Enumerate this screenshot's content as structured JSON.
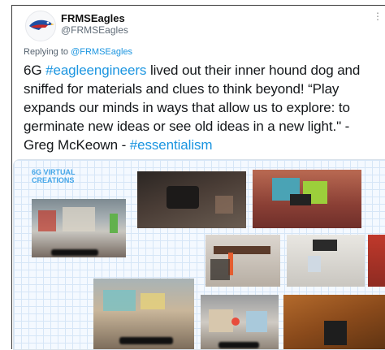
{
  "tweet": {
    "display_name": "FRMSEagles",
    "handle": "@FRMSEagles",
    "more_icon": "more-icon",
    "replying_prefix": "Replying to ",
    "replying_to": "@FRMSEagles",
    "text_1": "6G ",
    "hashtag_1": "#eagleengineers",
    "text_2": " lived out their inner hound dog and sniffed for materials and clues to think beyond! “Play expands our minds in ways that allow us to explore: to germinate new ideas or see old ideas in a new light.\" - Greg McKeown - ",
    "hashtag_2": "#essentialism",
    "link_color": "#1b95e0"
  },
  "media": {
    "label": "6G VIRTUAL CREATIONS",
    "label_color": "#42a5e8"
  }
}
